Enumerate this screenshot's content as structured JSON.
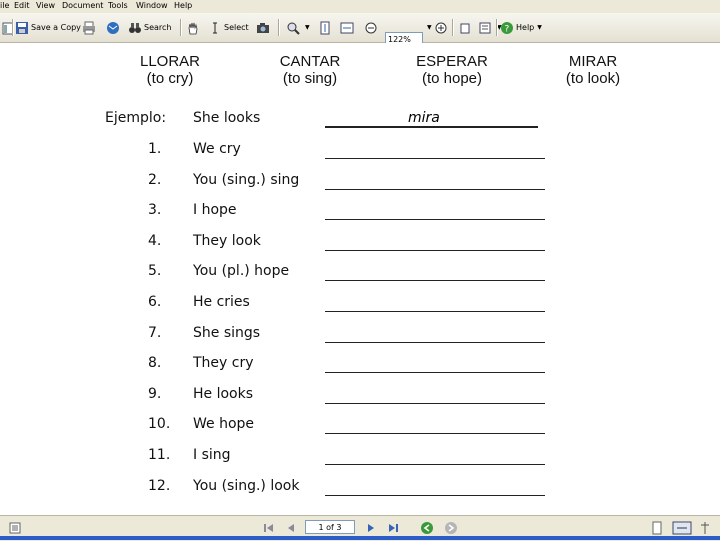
{
  "menu": [
    "ile",
    "Edit",
    "View",
    "Document",
    "Tools",
    "Window",
    "Help"
  ],
  "toolbar": {
    "save_copy": "Save a Copy",
    "search": "Search",
    "select": "Select",
    "zoom": "122%",
    "help": "Help"
  },
  "worksheet": {
    "verbs": [
      {
        "name": "LLORAR",
        "translation": "(to cry)"
      },
      {
        "name": "CANTAR",
        "translation": "(to sing)"
      },
      {
        "name": "ESPERAR",
        "translation": "(to hope)"
      },
      {
        "name": "MIRAR",
        "translation": "(to look)"
      }
    ],
    "example": {
      "label": "Ejemplo:",
      "prompt": "She looks",
      "answer": "mira"
    },
    "items": [
      {
        "num": "1.",
        "prompt": "We cry"
      },
      {
        "num": "2.",
        "prompt": "You (sing.) sing"
      },
      {
        "num": "3.",
        "prompt": "I hope"
      },
      {
        "num": "4.",
        "prompt": "They look"
      },
      {
        "num": "5.",
        "prompt": "You (pl.) hope"
      },
      {
        "num": "6.",
        "prompt": "He cries"
      },
      {
        "num": "7.",
        "prompt": "She sings"
      },
      {
        "num": "8.",
        "prompt": "They cry"
      },
      {
        "num": "9.",
        "prompt": "He looks"
      },
      {
        "num": "10.",
        "prompt": "We hope"
      },
      {
        "num": "11.",
        "prompt": "I sing"
      },
      {
        "num": "12.",
        "prompt": "You (sing.) look"
      }
    ]
  },
  "nav": {
    "page": "1 of 3"
  }
}
